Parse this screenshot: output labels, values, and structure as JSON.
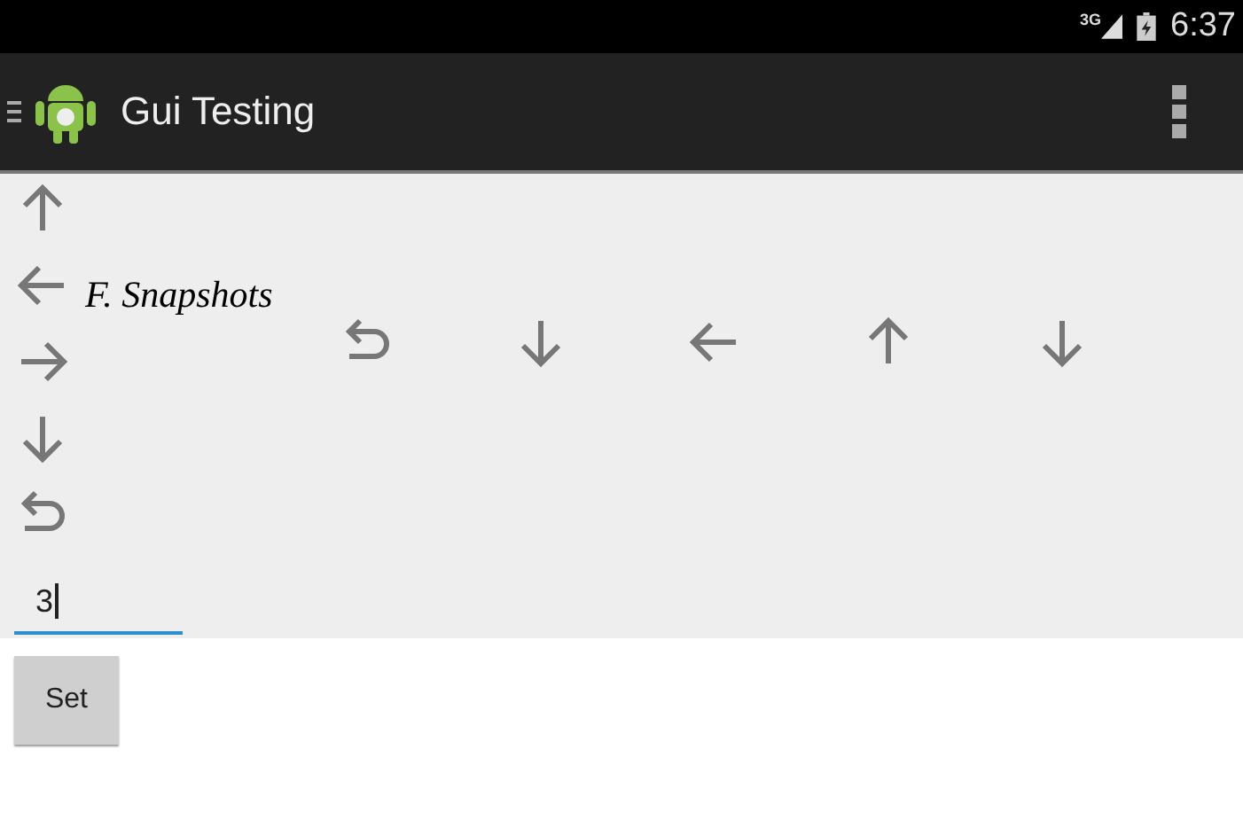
{
  "status_bar": {
    "network": "3G",
    "time": "6:37"
  },
  "action_bar": {
    "title": "Gui Testing"
  },
  "caption": "F. Snapshots",
  "arrow_column": [
    {
      "kind": "up"
    },
    {
      "kind": "left"
    },
    {
      "kind": "right"
    },
    {
      "kind": "down"
    },
    {
      "kind": "undo"
    }
  ],
  "arrow_row": [
    {
      "kind": "undo"
    },
    {
      "kind": "down"
    },
    {
      "kind": "left"
    },
    {
      "kind": "up"
    },
    {
      "kind": "down"
    }
  ],
  "input": {
    "value": "3"
  },
  "buttons": [
    "Set"
  ]
}
